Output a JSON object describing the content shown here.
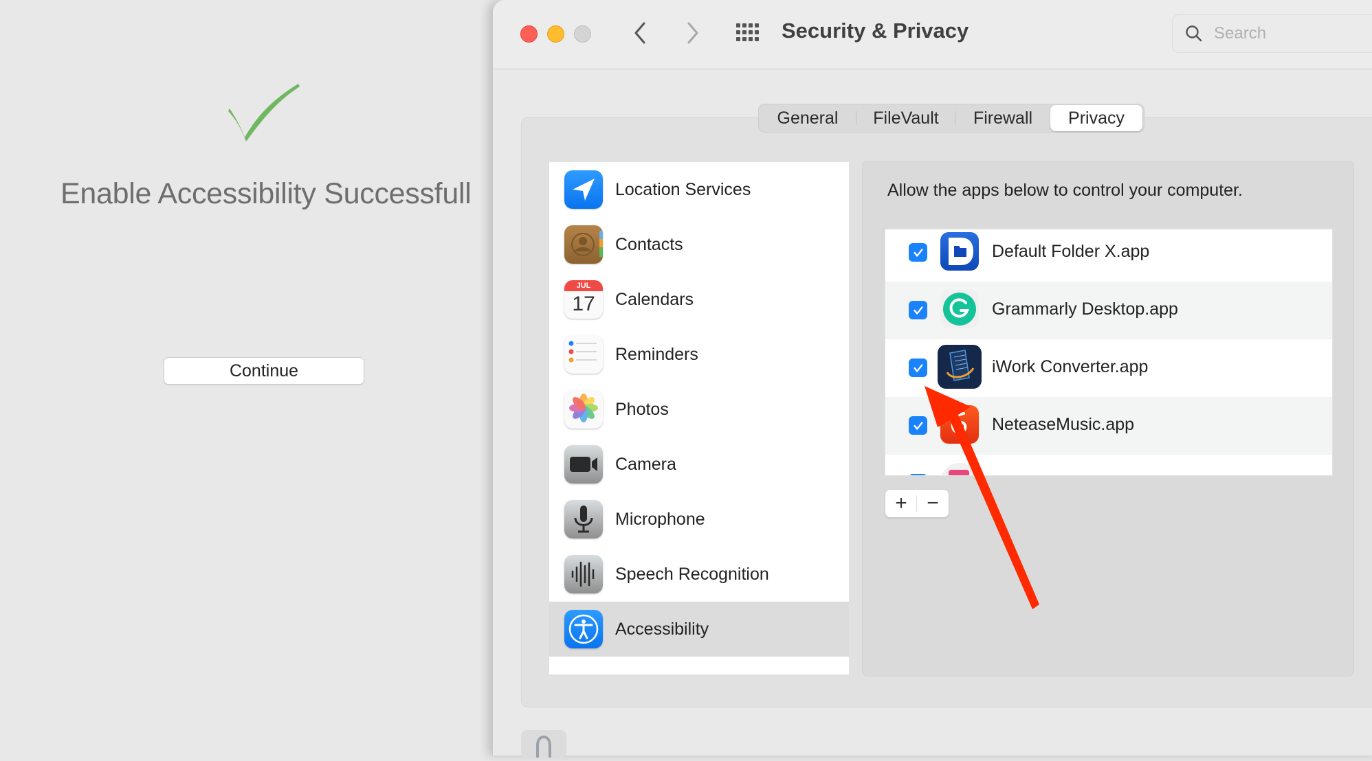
{
  "helper": {
    "status_icon": "green-check-icon",
    "title": "Enable Accessibility Successfull",
    "continue_label": "Continue"
  },
  "window": {
    "title": "Security & Privacy",
    "controls": [
      "close",
      "minimize",
      "zoom"
    ],
    "nav": {
      "back_icon": "chevron-left-icon",
      "forward_icon": "chevron-right-icon",
      "grid_icon": "show-all-grid-icon"
    },
    "search": {
      "placeholder": "Search",
      "value": ""
    }
  },
  "tabs": [
    {
      "label": "General",
      "selected": false
    },
    {
      "label": "FileVault",
      "selected": false
    },
    {
      "label": "Firewall",
      "selected": false
    },
    {
      "label": "Privacy",
      "selected": true
    }
  ],
  "categories": [
    {
      "label": "Location Services",
      "icon": "location-arrow-icon",
      "selected": false
    },
    {
      "label": "Contacts",
      "icon": "contacts-book-icon",
      "selected": false
    },
    {
      "label": "Calendars",
      "icon": "calendar-icon",
      "month": "JUL",
      "day": "17",
      "selected": false
    },
    {
      "label": "Reminders",
      "icon": "reminders-list-icon",
      "selected": false
    },
    {
      "label": "Photos",
      "icon": "photos-flower-icon",
      "selected": false
    },
    {
      "label": "Camera",
      "icon": "camera-icon",
      "selected": false
    },
    {
      "label": "Microphone",
      "icon": "microphone-icon",
      "selected": false
    },
    {
      "label": "Speech Recognition",
      "icon": "speech-waveform-icon",
      "selected": false
    },
    {
      "label": "Accessibility",
      "icon": "accessibility-person-icon",
      "selected": true
    }
  ],
  "detail": {
    "description": "Allow the apps below to control your computer.",
    "apps": [
      {
        "label": "Default Folder X.app",
        "checked": true,
        "icon": "default-folder-x-icon"
      },
      {
        "label": "Grammarly Desktop.app",
        "checked": true,
        "icon": "grammarly-icon"
      },
      {
        "label": "iWork Converter.app",
        "checked": true,
        "icon": "iwork-converter-icon"
      },
      {
        "label": "NeteaseMusic.app",
        "checked": true,
        "icon": "netease-music-icon"
      },
      {
        "label": "",
        "checked": true,
        "icon": "partially-hidden-app-icon"
      }
    ],
    "add_label": "+",
    "remove_label": "−"
  },
  "footer": {
    "lock_icon": "lock-icon"
  },
  "annotation": {
    "type": "red-arrow",
    "points_to": "iWork Converter.app checkbox",
    "color": "#ff2a00"
  }
}
